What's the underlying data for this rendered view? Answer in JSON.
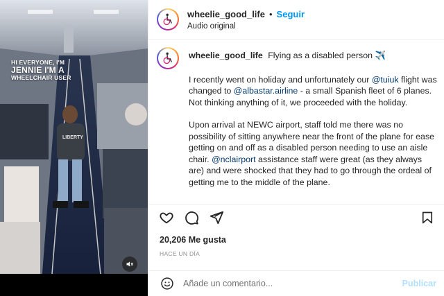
{
  "media": {
    "overlay_line1": "HI EVERYONE, I'M",
    "overlay_line2": "JENNIE I'M A",
    "overlay_line3": "WHEELCHAIR USER",
    "shirt_text": "LIBERTY",
    "mute_icon": "speaker-muted-icon"
  },
  "header": {
    "username": "wheelie_good_life",
    "separator": "•",
    "follow_label": "Seguir",
    "audio_label": "Audio original",
    "avatar_icon": "wheelchair-logo"
  },
  "caption": {
    "username": "wheelie_good_life",
    "title": "Flying as a disabled person ✈️",
    "p1": [
      {
        "text": "I recently went on holiday and unfortunately our ",
        "mention": false
      },
      {
        "text": "@tuiuk",
        "mention": true
      },
      {
        "text": " flight was changed to ",
        "mention": false
      },
      {
        "text": "@albastar.airline",
        "mention": true
      },
      {
        "text": " - a small Spanish fleet of 6 planes. Not thinking anything of it, we proceeded with the holiday.",
        "mention": false
      }
    ],
    "p2": [
      {
        "text": "Upon arrival at NEWC airport, staff told me there was no possibility of sitting anywhere near the front of the plane for ease getting on and off as a disabled person needing to use an aisle chair. ",
        "mention": false
      },
      {
        "text": "@nclairport",
        "mention": true
      },
      {
        "text": " assistance staff were great (as they always are) and were shocked that they had to go through the ordeal of getting me to the middle of the plane.",
        "mention": false
      }
    ]
  },
  "actions": {
    "like_icon": "heart-icon",
    "comment_icon": "comment-icon",
    "share_icon": "paper-plane-icon",
    "save_icon": "bookmark-icon"
  },
  "likes_text": "20,206 Me gusta",
  "date_text": "HACE UN DÍA",
  "comment": {
    "emoji_icon": "smiley-icon",
    "placeholder": "Añade un comentario...",
    "post_label": "Publicar"
  },
  "colors": {
    "accent": "#0095f6",
    "mention": "#00376b",
    "post_disabled": "#b2dffc",
    "muted_text": "#8e8e8e"
  }
}
